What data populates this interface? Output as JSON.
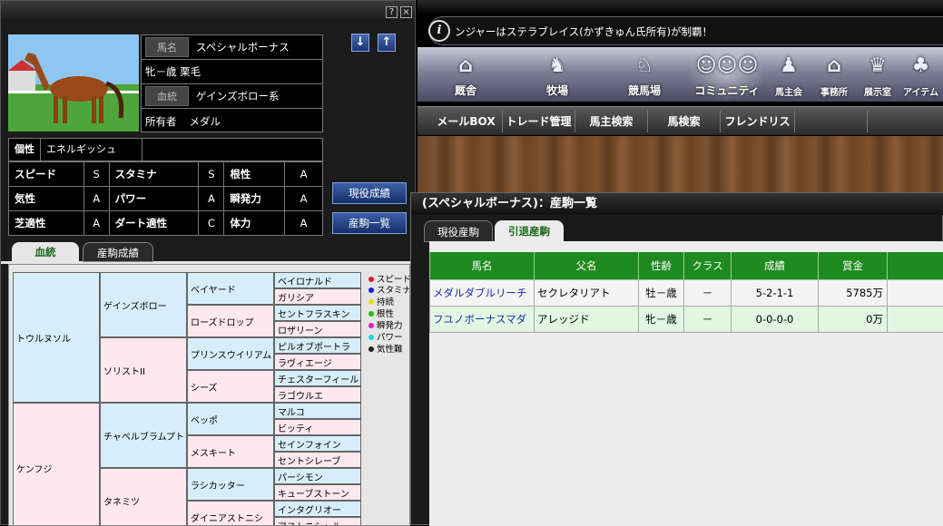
{
  "window_controls": {
    "help": "?",
    "close": "×"
  },
  "horse": {
    "name_tag": "馬名",
    "name": "スペシャルボーナス",
    "sex_age_color": "牝－歳 栗毛",
    "lineage_tag": "血統",
    "lineage": "ゲインズボロー系",
    "owner_label": "所有者",
    "owner": "メダル",
    "personality_label": "個性",
    "personality": "エネルギッシュ"
  },
  "nav_arrows": {
    "down": "↓",
    "up": "↑"
  },
  "stats": [
    [
      {
        "l": "スピード",
        "v": "S"
      },
      {
        "l": "スタミナ",
        "v": "S"
      },
      {
        "l": "根性",
        "v": "A"
      }
    ],
    [
      {
        "l": "気性",
        "v": "A"
      },
      {
        "l": "パワー",
        "v": "A"
      },
      {
        "l": "瞬発力",
        "v": "A"
      }
    ],
    [
      {
        "l": "芝適性",
        "v": "A"
      },
      {
        "l": "ダート適性",
        "v": "C"
      },
      {
        "l": "体力",
        "v": "A"
      }
    ]
  ],
  "side_buttons": {
    "race_results": "現役成績",
    "offspring_list": "産駒一覧"
  },
  "left_tabs": {
    "pedigree": "血統",
    "offspring_results": "産駒成績"
  },
  "pedigree": {
    "g1": [
      "トウルヌソル",
      "ケンフジ"
    ],
    "g2": [
      "ゲインズボロー",
      "ソリストII",
      "チャペルブラムプト",
      "タネミツ"
    ],
    "g3": [
      "ベイヤード",
      "ローズドロップ",
      "プリンスウイリアム",
      "シーズ",
      "ベッポ",
      "メスキート",
      "ラシカッター",
      "ダイニアストニシ"
    ],
    "g4": [
      "ベイロナルド",
      "ガリシア",
      "セントフラスキン",
      "ロザリーン",
      "ピルオブポートラ",
      "ラヴィエージ",
      "チェスターフィール",
      "ラゴウルエ",
      "マルコ",
      "ビッティ",
      "セインフォイン",
      "セントシレーブ",
      "パーシモン",
      "キューブストーン",
      "インタグリオー",
      "アストニシャル"
    ]
  },
  "legend": [
    {
      "label": "スピード",
      "color": "#e02020"
    },
    {
      "label": "スタミナ",
      "color": "#2020d0"
    },
    {
      "label": "持続",
      "color": "#e0e020"
    },
    {
      "label": "根性",
      "color": "#20c020"
    },
    {
      "label": "瞬発力",
      "color": "#e020c0"
    },
    {
      "label": "パワー",
      "color": "#20d0e0"
    },
    {
      "label": "気性難",
      "color": "#222222"
    }
  ],
  "ticker": {
    "text": "ンジャーはステラブレイス(かずきゅん氏所有)が制覇！",
    "icon": "info-icon"
  },
  "main_menu": [
    "厩舎",
    "牧場",
    "競馬場",
    "コミュニティ",
    "馬主会",
    "事務所",
    "展示室",
    "アイテム"
  ],
  "sub_menu": [
    "メールBOX",
    "トレード管理",
    "馬主検索",
    "馬検索",
    "フレンドリスト"
  ],
  "offspring_window": {
    "title": "(スペシャルボーナス)：産駒一覧",
    "tabs": [
      "現役産駒",
      "引退産駒"
    ],
    "columns": [
      "馬名",
      "父名",
      "性齢",
      "クラス",
      "成績",
      "賞金"
    ],
    "rows": [
      [
        "メダルダブルリーチ",
        "セクレタリアト",
        "牡－歳",
        "－",
        "5-2-1-1",
        "5785万"
      ],
      [
        "フユノボーナスマダ",
        "アレッジド",
        "牝－歳",
        "－",
        "0-0-0-0",
        "0万"
      ]
    ]
  }
}
